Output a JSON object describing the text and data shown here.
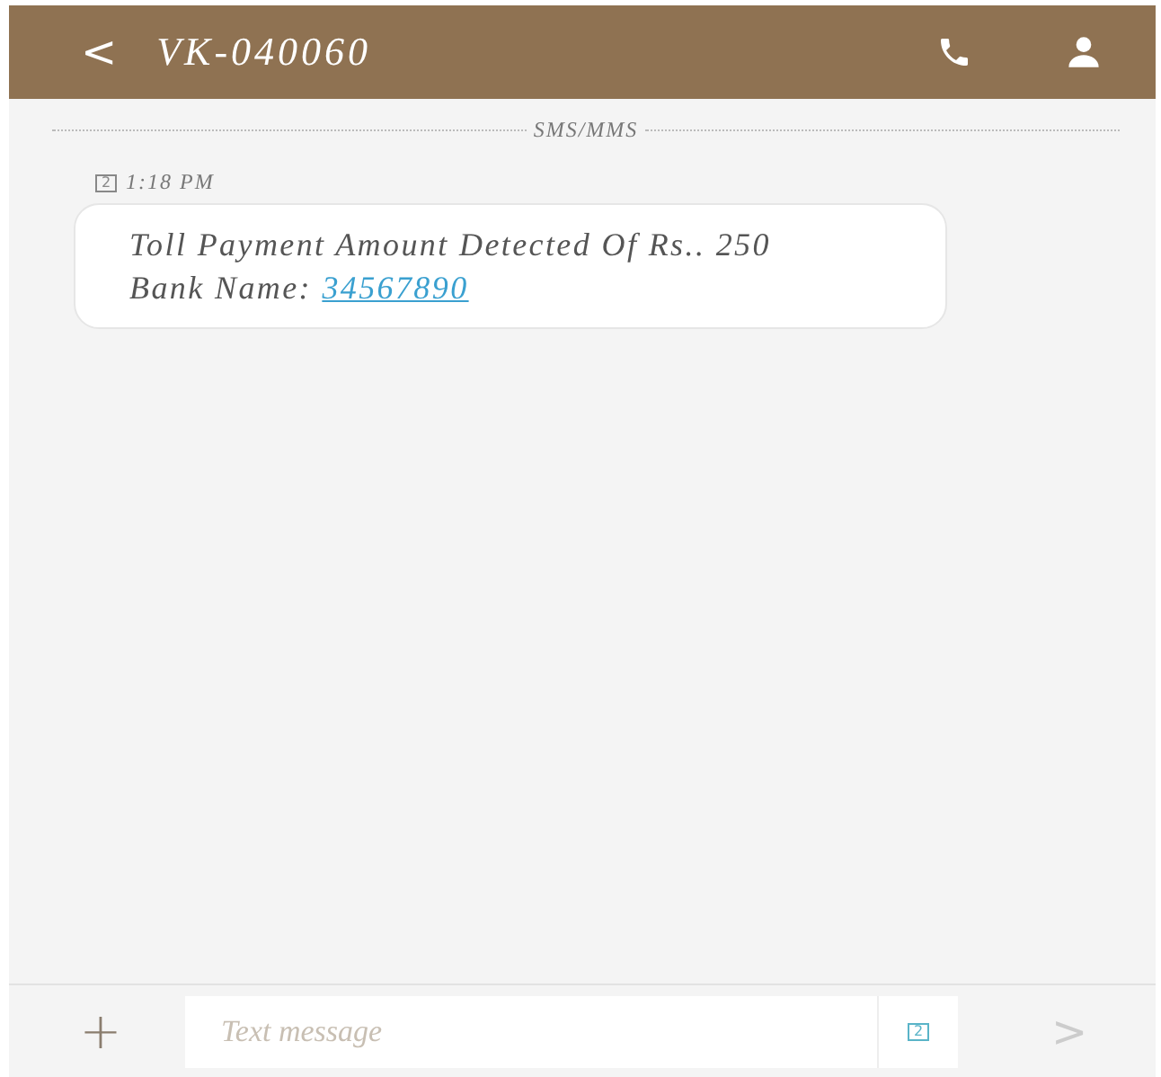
{
  "header": {
    "back": "<",
    "title": "VK-040060"
  },
  "divider_label": "SMS/MMS",
  "messages": [
    {
      "sim": "2",
      "time": "1:18 PM",
      "text": "Toll Payment Amount Detected Of Rs.. 250 Bank Name: ",
      "link": "34567890"
    }
  ],
  "composer": {
    "add": "+",
    "placeholder": "Text message",
    "sim": "2",
    "send": ">"
  }
}
